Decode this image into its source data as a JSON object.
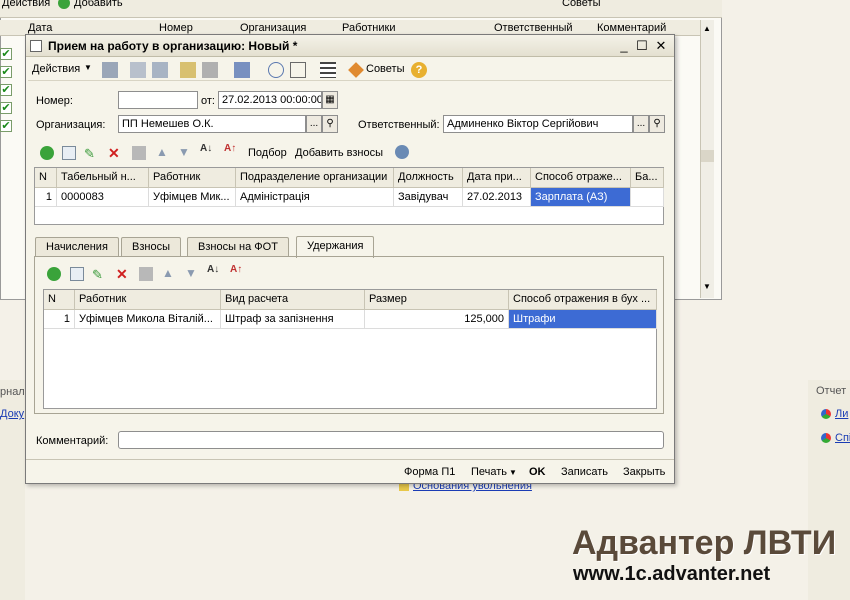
{
  "background": {
    "toolbar": {
      "actions": "Действия",
      "add": "Добавить",
      "tips": "Советы"
    },
    "columns": [
      "Дата",
      "Номер",
      "Организация",
      "Работники",
      "Ответственный",
      "Комментарий"
    ],
    "left_panel_title": "рнал",
    "left_link": "Доку",
    "right_panel_title": "Отчет",
    "right_links": [
      "Ли",
      "Спі"
    ],
    "bottom_link": "Основания увольнения"
  },
  "dialog": {
    "title": "Прием на работу в организацию: Новый *",
    "toolbar": {
      "actions": "Действия",
      "tips": "Советы"
    },
    "form": {
      "number_label": "Номер:",
      "number_value": "",
      "date_label": "от:",
      "date_value": "27.02.2013 00:00:00",
      "org_label": "Организация:",
      "org_value": "ПП Немешев О.К.",
      "resp_label": "Ответственный:",
      "resp_value": "Админенко Віктор Сергійович",
      "comment_label": "Комментарий:",
      "comment_value": ""
    },
    "grid_toolbar": {
      "pick": "Подбор",
      "add_contrib": "Добавить взносы"
    },
    "main_grid": {
      "columns": [
        "N",
        "Табельный н...",
        "Работник",
        "Подразделение организации",
        "Должность",
        "Дата при...",
        "Способ отраже...",
        "Ба..."
      ],
      "rows": [
        [
          "1",
          "0000083",
          "Уфімцев Мик...",
          "Адміністрація",
          "Завідувач",
          "27.02.2013",
          "Зарплата (АЗ)",
          ""
        ]
      ]
    },
    "tabs": [
      "Начисления",
      "Взносы",
      "Взносы на ФОТ",
      "Удержания"
    ],
    "active_tab": "Удержания",
    "sub_grid": {
      "columns": [
        "N",
        "Работник",
        "Вид расчета",
        "Размер",
        "Способ отражения в бух ..."
      ],
      "rows": [
        [
          "1",
          "Уфімцев Микола Віталій...",
          "Штраф за запізнення",
          "125,000",
          "Штрафи"
        ]
      ]
    },
    "bottom": {
      "form": "Форма П1",
      "print": "Печать",
      "ok": "OK",
      "save": "Записать",
      "close": "Закрыть"
    }
  },
  "watermark": {
    "brand": "Адвантер ЛВТИ",
    "url": "www.1c.advanter.net"
  }
}
